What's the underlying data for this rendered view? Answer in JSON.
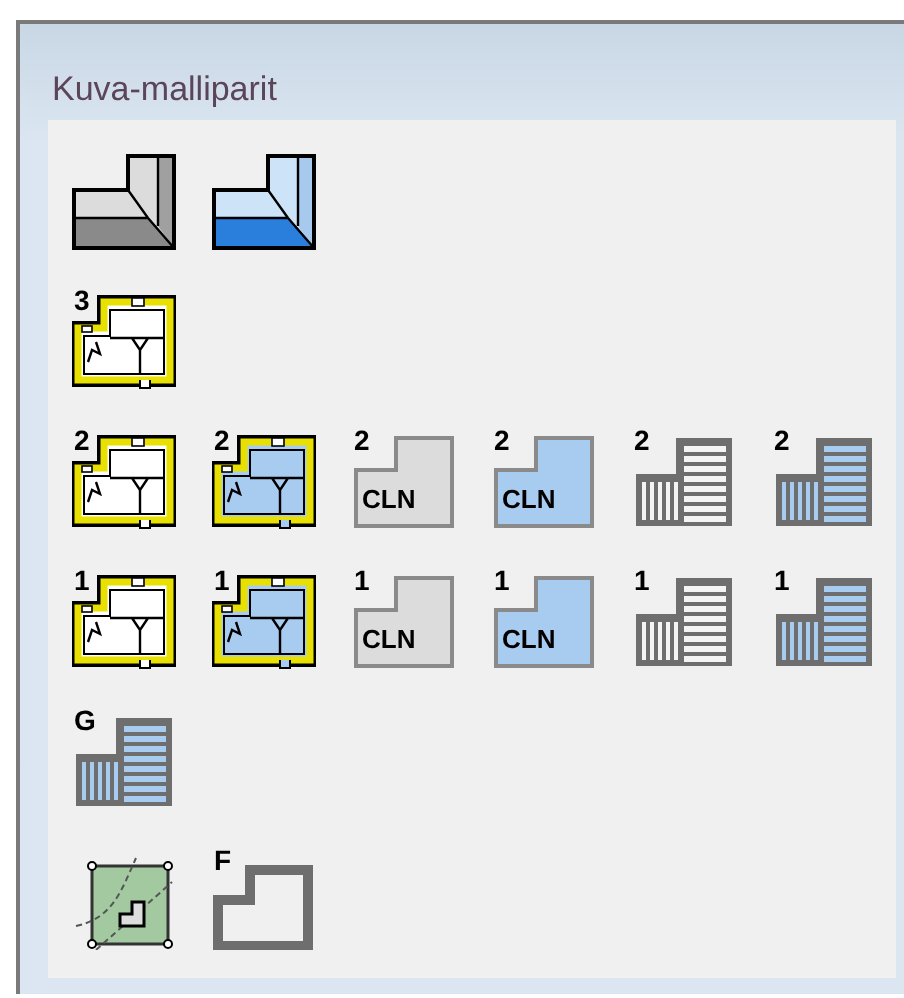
{
  "panel": {
    "title": "Kuva-malliparit",
    "rows": [
      {
        "items": [
          {
            "kind": "corner"
          },
          {
            "kind": "bluecorner"
          }
        ]
      },
      {
        "items": [
          {
            "kind": "floorplan",
            "badge": "3"
          }
        ]
      },
      {
        "items": [
          {
            "kind": "floorplan",
            "badge": "2"
          },
          {
            "kind": "bluefloorplan",
            "badge": "2"
          },
          {
            "kind": "cln",
            "badge": "2",
            "label": "CLN"
          },
          {
            "kind": "bluecln",
            "badge": "2",
            "label": "CLN"
          },
          {
            "kind": "building",
            "badge": "2"
          },
          {
            "kind": "bluebuilding",
            "badge": "2"
          }
        ]
      },
      {
        "items": [
          {
            "kind": "floorplan",
            "badge": "1"
          },
          {
            "kind": "bluefloorplan",
            "badge": "1"
          },
          {
            "kind": "cln",
            "badge": "1",
            "label": "CLN"
          },
          {
            "kind": "bluecln",
            "badge": "1",
            "label": "CLN"
          },
          {
            "kind": "building",
            "badge": "1"
          },
          {
            "kind": "bluebuilding",
            "badge": "1"
          }
        ]
      },
      {
        "items": [
          {
            "kind": "bluebuilding",
            "badge": "G"
          }
        ]
      },
      {
        "items": [
          {
            "kind": "site"
          },
          {
            "kind": "outline",
            "badge": "F"
          }
        ]
      }
    ]
  }
}
